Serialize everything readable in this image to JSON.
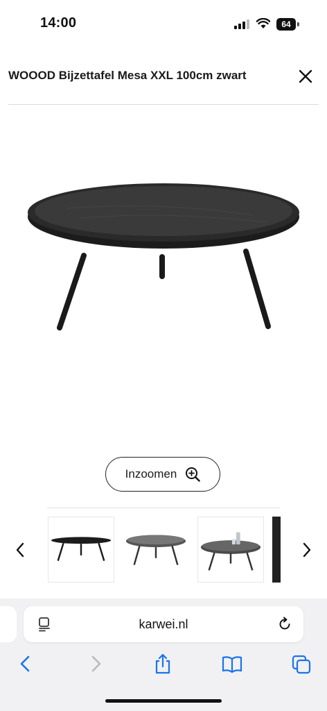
{
  "status_bar": {
    "time": "14:00",
    "battery": "64"
  },
  "header": {
    "title": "WOOOD Bijzettafel Mesa XXL 100cm zwart"
  },
  "product": {
    "zoom_label": "Inzoomen"
  },
  "browser": {
    "url": "karwei.nl"
  },
  "icons": {
    "close": "close-icon",
    "zoom": "zoom-in-icon",
    "prev": "chevron-left-icon",
    "next": "chevron-right-icon",
    "page": "page-menu-icon",
    "reload": "reload-icon",
    "back": "back-icon",
    "forward": "forward-icon",
    "share": "share-icon",
    "bookmarks": "bookmarks-icon",
    "tabs": "tabs-icon"
  },
  "colors": {
    "accent": "#1a73e8",
    "product": "#1c1c1c"
  }
}
